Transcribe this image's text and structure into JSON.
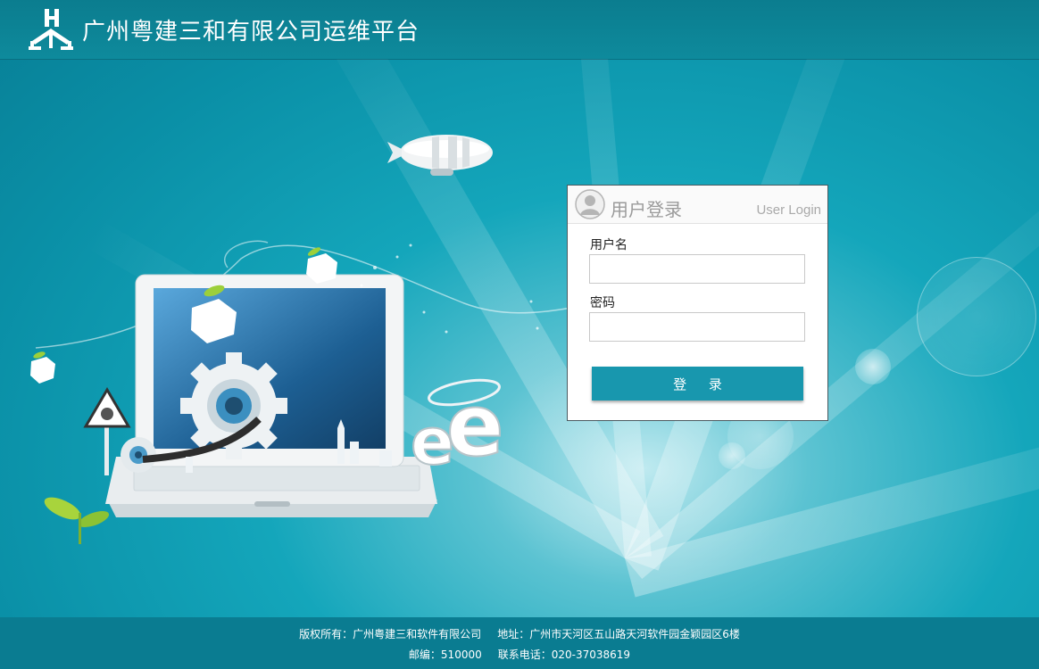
{
  "header": {
    "title": "广州粤建三和有限公司运维平台"
  },
  "login": {
    "title": "用户登录",
    "title_en": "User Login",
    "username_label": "用户名",
    "username_value": "",
    "password_label": "密码",
    "password_value": "",
    "submit_label": "登 录"
  },
  "footer": {
    "copyright": "版权所有：广州粤建三和软件有限公司",
    "address": "地址：广州市天河区五山路天河软件园金颖园区6楼",
    "postcode": "邮编：510000",
    "phone": "联系电话：020-37038619"
  },
  "illustration": {
    "sign_text": "e"
  },
  "colors": {
    "header_bg": "#0b7d8f",
    "button_bg": "#1897ae",
    "footer_bg": "#0a7c91",
    "page_bg": "#14a6bb"
  },
  "icons": [
    "logo-icon",
    "user-avatar-icon",
    "airship-icon",
    "laptop-icon",
    "gear-icon",
    "warning-sign-icon",
    "ie-logo-icon",
    "leaf-icon"
  ]
}
